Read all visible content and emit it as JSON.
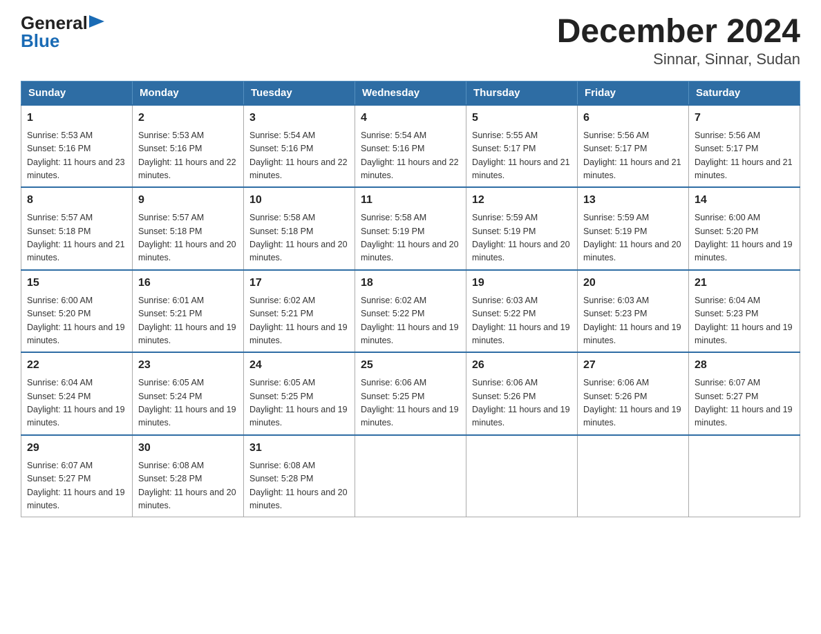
{
  "logo": {
    "general": "General",
    "blue": "Blue",
    "arrow": "▶"
  },
  "title": "December 2024",
  "subtitle": "Sinnar, Sinnar, Sudan",
  "days": [
    "Sunday",
    "Monday",
    "Tuesday",
    "Wednesday",
    "Thursday",
    "Friday",
    "Saturday"
  ],
  "weeks": [
    [
      {
        "num": "1",
        "sunrise": "5:53 AM",
        "sunset": "5:16 PM",
        "daylight": "11 hours and 23 minutes."
      },
      {
        "num": "2",
        "sunrise": "5:53 AM",
        "sunset": "5:16 PM",
        "daylight": "11 hours and 22 minutes."
      },
      {
        "num": "3",
        "sunrise": "5:54 AM",
        "sunset": "5:16 PM",
        "daylight": "11 hours and 22 minutes."
      },
      {
        "num": "4",
        "sunrise": "5:54 AM",
        "sunset": "5:16 PM",
        "daylight": "11 hours and 22 minutes."
      },
      {
        "num": "5",
        "sunrise": "5:55 AM",
        "sunset": "5:17 PM",
        "daylight": "11 hours and 21 minutes."
      },
      {
        "num": "6",
        "sunrise": "5:56 AM",
        "sunset": "5:17 PM",
        "daylight": "11 hours and 21 minutes."
      },
      {
        "num": "7",
        "sunrise": "5:56 AM",
        "sunset": "5:17 PM",
        "daylight": "11 hours and 21 minutes."
      }
    ],
    [
      {
        "num": "8",
        "sunrise": "5:57 AM",
        "sunset": "5:18 PM",
        "daylight": "11 hours and 21 minutes."
      },
      {
        "num": "9",
        "sunrise": "5:57 AM",
        "sunset": "5:18 PM",
        "daylight": "11 hours and 20 minutes."
      },
      {
        "num": "10",
        "sunrise": "5:58 AM",
        "sunset": "5:18 PM",
        "daylight": "11 hours and 20 minutes."
      },
      {
        "num": "11",
        "sunrise": "5:58 AM",
        "sunset": "5:19 PM",
        "daylight": "11 hours and 20 minutes."
      },
      {
        "num": "12",
        "sunrise": "5:59 AM",
        "sunset": "5:19 PM",
        "daylight": "11 hours and 20 minutes."
      },
      {
        "num": "13",
        "sunrise": "5:59 AM",
        "sunset": "5:19 PM",
        "daylight": "11 hours and 20 minutes."
      },
      {
        "num": "14",
        "sunrise": "6:00 AM",
        "sunset": "5:20 PM",
        "daylight": "11 hours and 19 minutes."
      }
    ],
    [
      {
        "num": "15",
        "sunrise": "6:00 AM",
        "sunset": "5:20 PM",
        "daylight": "11 hours and 19 minutes."
      },
      {
        "num": "16",
        "sunrise": "6:01 AM",
        "sunset": "5:21 PM",
        "daylight": "11 hours and 19 minutes."
      },
      {
        "num": "17",
        "sunrise": "6:02 AM",
        "sunset": "5:21 PM",
        "daylight": "11 hours and 19 minutes."
      },
      {
        "num": "18",
        "sunrise": "6:02 AM",
        "sunset": "5:22 PM",
        "daylight": "11 hours and 19 minutes."
      },
      {
        "num": "19",
        "sunrise": "6:03 AM",
        "sunset": "5:22 PM",
        "daylight": "11 hours and 19 minutes."
      },
      {
        "num": "20",
        "sunrise": "6:03 AM",
        "sunset": "5:23 PM",
        "daylight": "11 hours and 19 minutes."
      },
      {
        "num": "21",
        "sunrise": "6:04 AM",
        "sunset": "5:23 PM",
        "daylight": "11 hours and 19 minutes."
      }
    ],
    [
      {
        "num": "22",
        "sunrise": "6:04 AM",
        "sunset": "5:24 PM",
        "daylight": "11 hours and 19 minutes."
      },
      {
        "num": "23",
        "sunrise": "6:05 AM",
        "sunset": "5:24 PM",
        "daylight": "11 hours and 19 minutes."
      },
      {
        "num": "24",
        "sunrise": "6:05 AM",
        "sunset": "5:25 PM",
        "daylight": "11 hours and 19 minutes."
      },
      {
        "num": "25",
        "sunrise": "6:06 AM",
        "sunset": "5:25 PM",
        "daylight": "11 hours and 19 minutes."
      },
      {
        "num": "26",
        "sunrise": "6:06 AM",
        "sunset": "5:26 PM",
        "daylight": "11 hours and 19 minutes."
      },
      {
        "num": "27",
        "sunrise": "6:06 AM",
        "sunset": "5:26 PM",
        "daylight": "11 hours and 19 minutes."
      },
      {
        "num": "28",
        "sunrise": "6:07 AM",
        "sunset": "5:27 PM",
        "daylight": "11 hours and 19 minutes."
      }
    ],
    [
      {
        "num": "29",
        "sunrise": "6:07 AM",
        "sunset": "5:27 PM",
        "daylight": "11 hours and 19 minutes."
      },
      {
        "num": "30",
        "sunrise": "6:08 AM",
        "sunset": "5:28 PM",
        "daylight": "11 hours and 20 minutes."
      },
      {
        "num": "31",
        "sunrise": "6:08 AM",
        "sunset": "5:28 PM",
        "daylight": "11 hours and 20 minutes."
      },
      null,
      null,
      null,
      null
    ]
  ]
}
